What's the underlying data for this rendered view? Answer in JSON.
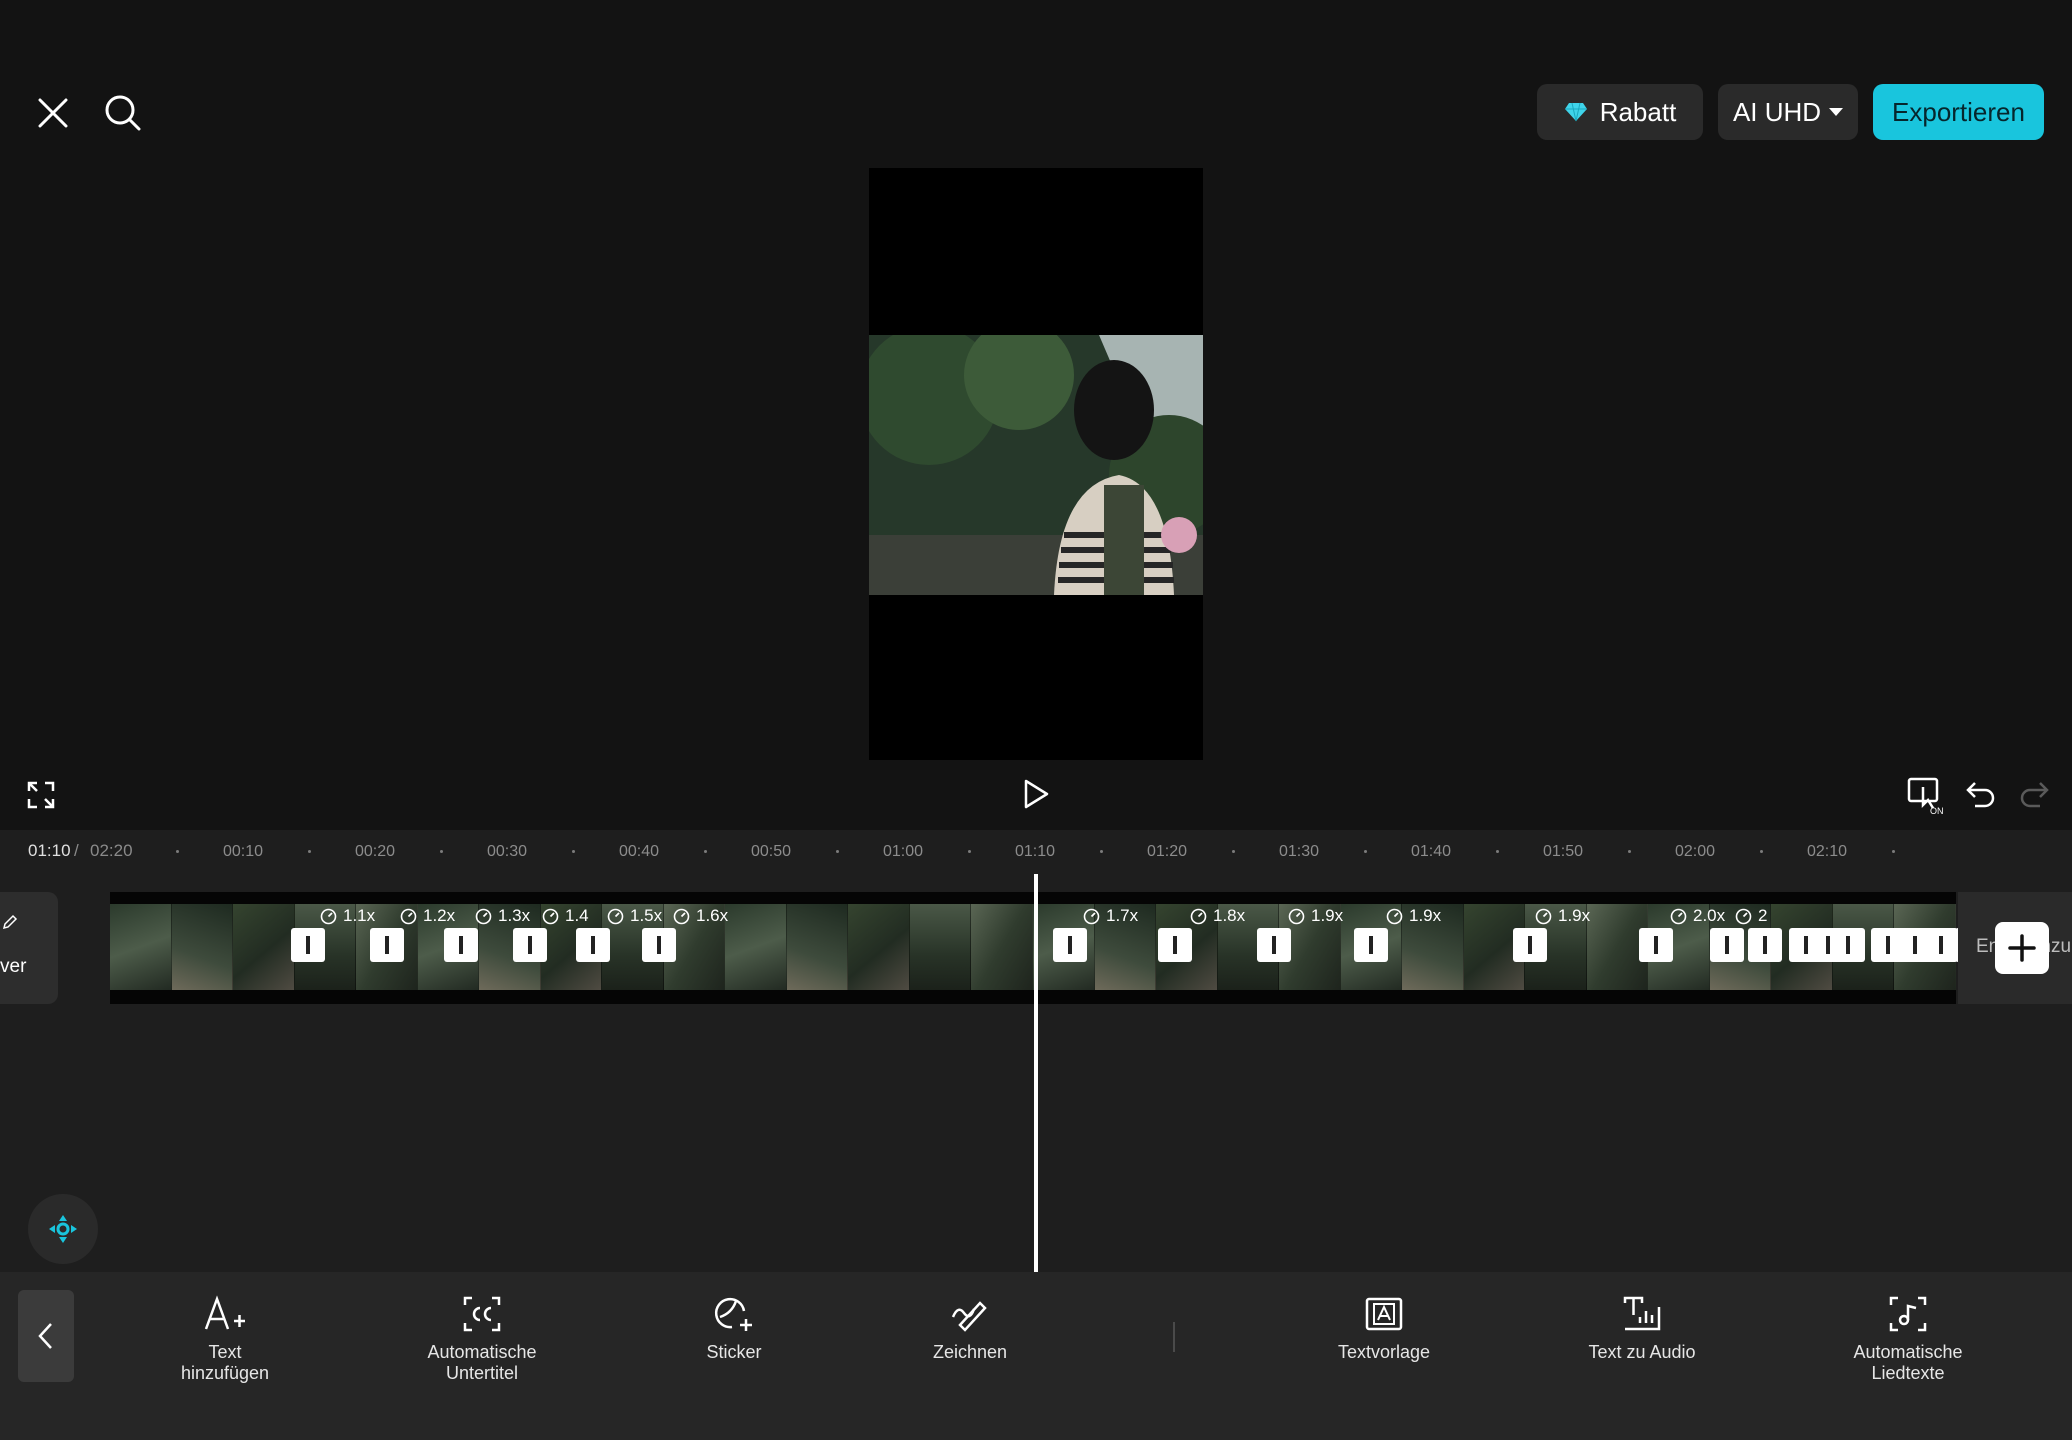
{
  "top_bar": {
    "close_icon": "close-icon",
    "search_icon": "search-icon",
    "rabatt_label": "Rabatt",
    "rabatt_icon": "gem-icon",
    "quality_label": "AI UHD",
    "export_label": "Exportieren",
    "accent_color": "#19c5dd"
  },
  "playback": {
    "current_time": "01:10",
    "separator": "/",
    "total_time": "02:20"
  },
  "ruler": [
    "00:10",
    "00:20",
    "00:30",
    "00:40",
    "00:50",
    "01:00",
    "01:10",
    "01:20",
    "01:30",
    "01:40",
    "01:50",
    "02:00",
    "02:10"
  ],
  "timeline": {
    "cover_label": "ver",
    "end_label": "Ende hinzu",
    "speeds": [
      "1.1x",
      "1.2x",
      "1.3x",
      "1.4",
      "1.5x",
      "1.6x",
      "1.7x",
      "1.8x",
      "1.9x",
      "1.9x",
      "1.9x",
      "2.0x",
      "2"
    ]
  },
  "toolbar": {
    "tools": [
      {
        "label": "Text\nhinzufügen",
        "icon": "text-add-icon"
      },
      {
        "label": "Automatische\nUntertitel",
        "icon": "captions-icon"
      },
      {
        "label": "Sticker",
        "icon": "sticker-icon"
      },
      {
        "label": "Zeichnen",
        "icon": "draw-icon"
      },
      {
        "label": "Textvorlage",
        "icon": "text-template-icon"
      },
      {
        "label": "Text zu Audio",
        "icon": "text-to-audio-icon"
      },
      {
        "label": "Automatische\nLiedtexte",
        "icon": "lyrics-icon"
      }
    ]
  }
}
